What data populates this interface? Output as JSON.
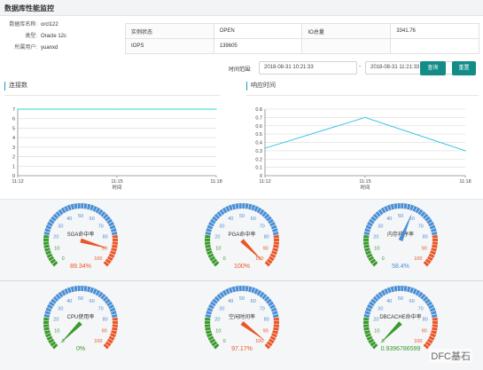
{
  "window": {
    "title": "数据库性能监控"
  },
  "db_info": [
    {
      "label": "数据库名称:",
      "value": "orcl122"
    },
    {
      "label": "类型:",
      "value": "Oracle 12c"
    },
    {
      "label": "所属用户:",
      "value": "yuanxd"
    }
  ],
  "stats": {
    "instance_status_label": "实例状态",
    "instance_status_value": "OPEN",
    "io_total_label": "IO总量",
    "io_total_value": "3341.76",
    "iops_label": "IOPS",
    "iops_value": "139605"
  },
  "time_range": {
    "label": "时间范围:",
    "start": "2018-08-31 10:21:33",
    "separator": "-",
    "end": "2018-08-31 11:21:33",
    "query_label": "查询",
    "reset_label": "重置"
  },
  "colors": {
    "accent": "#138c87",
    "connections_line": "#2fd7cf",
    "response_line": "#3ec5e6",
    "gauge_blue": "#4a8fd4",
    "gauge_green": "#3a9a2c",
    "gauge_red": "#e8572a",
    "value_red": "#e8572a",
    "value_blue": "#4a8fd4",
    "value_green": "#3a9a2c"
  },
  "chart_data": [
    {
      "type": "line",
      "title": "连接数",
      "xlabel": "时间",
      "ylabel": "",
      "categories": [
        "11:12",
        "11:15",
        "11:18"
      ],
      "x": [
        0,
        1,
        2
      ],
      "y": [
        7,
        7,
        7
      ],
      "ylim": [
        0,
        7
      ],
      "yticks": [
        "0",
        "1",
        "2",
        "3",
        "4",
        "5",
        "6",
        "7"
      ],
      "grid": true
    },
    {
      "type": "line",
      "title": "响应时间",
      "xlabel": "时间",
      "ylabel": "",
      "categories": [
        "11:12",
        "11:15",
        "11:18"
      ],
      "x": [
        0,
        1,
        2
      ],
      "y": [
        0.33,
        0.7,
        0.3
      ],
      "ylim": [
        0,
        0.8
      ],
      "yticks": [
        "0",
        "0.1",
        "0.2",
        "0.3",
        "0.4",
        "0.5",
        "0.6",
        "0.7",
        "0.8"
      ],
      "grid": true
    }
  ],
  "gauge_ticks": [
    "0",
    "10",
    "20",
    "30",
    "40",
    "50",
    "60",
    "70",
    "80",
    "90",
    "100"
  ],
  "gauges": [
    {
      "name": "SGA命中率",
      "value": 89.34,
      "display": "89.34%",
      "value_color": "#e8572a"
    },
    {
      "name": "PGA命中率",
      "value": 100,
      "display": "100%",
      "value_color": "#e8572a"
    },
    {
      "name": "内存排序率",
      "value": 58.4,
      "display": "58.4%",
      "value_color": "#4a8fd4"
    },
    {
      "name": "CPU使用率",
      "value": 0,
      "display": "0%",
      "value_color": "#3a9a2c"
    },
    {
      "name": "空闲时间率",
      "value": 97.17,
      "display": "97.17%",
      "value_color": "#e8572a"
    },
    {
      "name": "DBCACHE命中率",
      "value": 0,
      "display": "0.9396786599",
      "value_color": "#3a9a2c"
    }
  ],
  "watermark": "DFC基石"
}
